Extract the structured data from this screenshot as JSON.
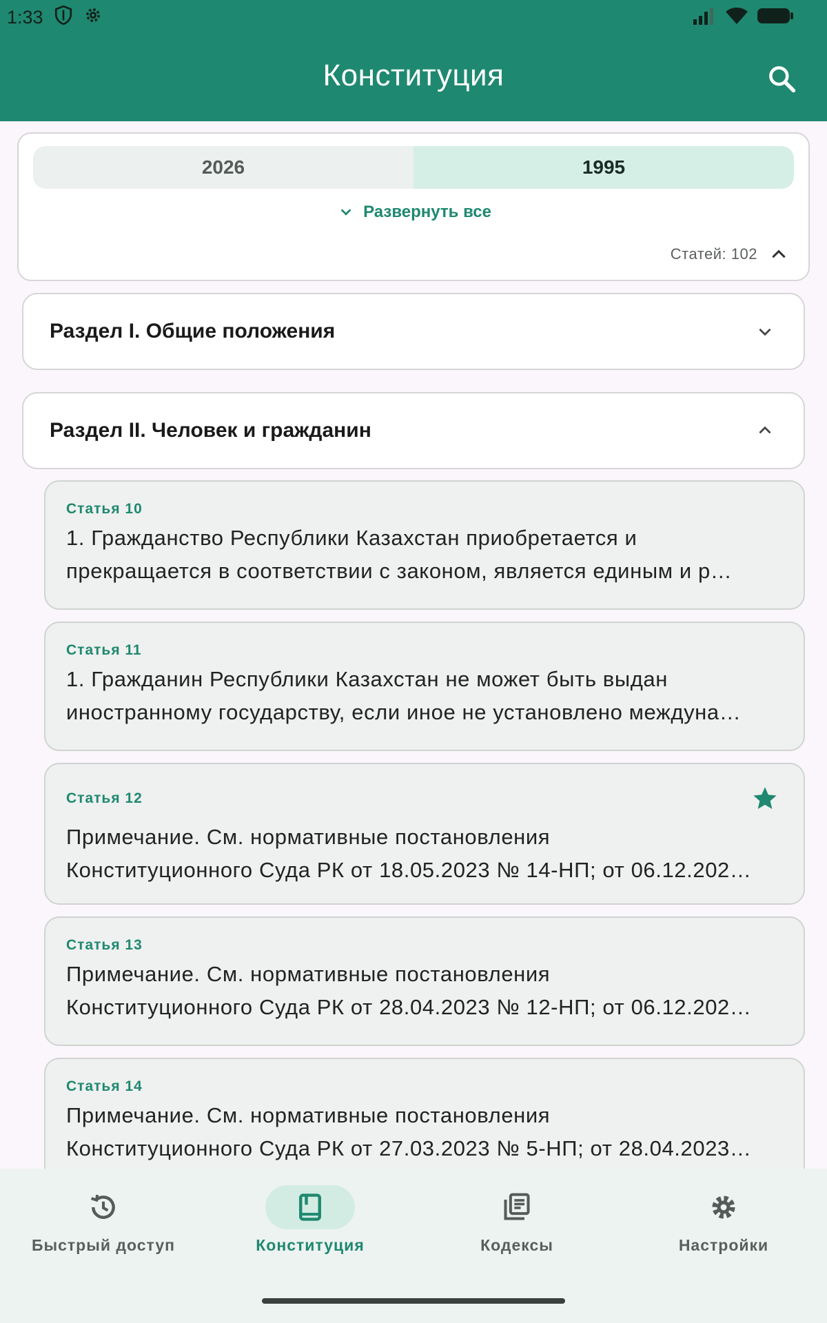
{
  "status_bar": {
    "time": "1:33"
  },
  "header": {
    "title": "Конституция"
  },
  "toggle": {
    "options": [
      "2026",
      "1995"
    ],
    "selected": "1995"
  },
  "expand_all_label": "Развернуть все",
  "articles_count_label": "Статей: 102",
  "sections": [
    {
      "title": "Раздел I. Общие положения",
      "expanded": false
    },
    {
      "title": "Раздел II. Человек и гражданин",
      "expanded": true
    }
  ],
  "articles": [
    {
      "label": "Статья 10",
      "line1": "1. Гражданство Республики Казахстан приобретается и",
      "line2": "прекращается в соответствии с законом, является единым и р…",
      "favorite": false
    },
    {
      "label": "Статья 11",
      "line1": "1. Гражданин Республики Казахстан не может быть выдан",
      "line2": "иностранному государству, если иное не установлено междуна…",
      "favorite": false
    },
    {
      "label": "Статья 12",
      "line1": "Примечание. См. нормативные постановления",
      "line2": "Конституционного Суда РК от 18.05.2023 № 14-НП; от 06.12.202…",
      "favorite": true
    },
    {
      "label": "Статья 13",
      "line1": "Примечание. См. нормативные постановления",
      "line2": "Конституционного Суда РК от 28.04.2023 № 12-НП; от 06.12.202…",
      "favorite": false
    },
    {
      "label": "Статья 14",
      "line1": "Примечание. См. нормативные постановления",
      "line2": "Конституционного Суда РК от 27.03.2023 № 5-НП; от 28.04.2023…",
      "favorite": false
    }
  ],
  "bottom_nav": [
    {
      "label": "Быстрый доступ",
      "icon": "history-icon",
      "active": false
    },
    {
      "label": "Конституция",
      "icon": "book-icon",
      "active": true
    },
    {
      "label": "Кодексы",
      "icon": "library-icon",
      "active": false
    },
    {
      "label": "Настройки",
      "icon": "gear-icon",
      "active": false
    }
  ],
  "colors": {
    "primary": "#1f8870",
    "selected_segment": "#d5efe6",
    "card_bg": "#eef1ef"
  }
}
